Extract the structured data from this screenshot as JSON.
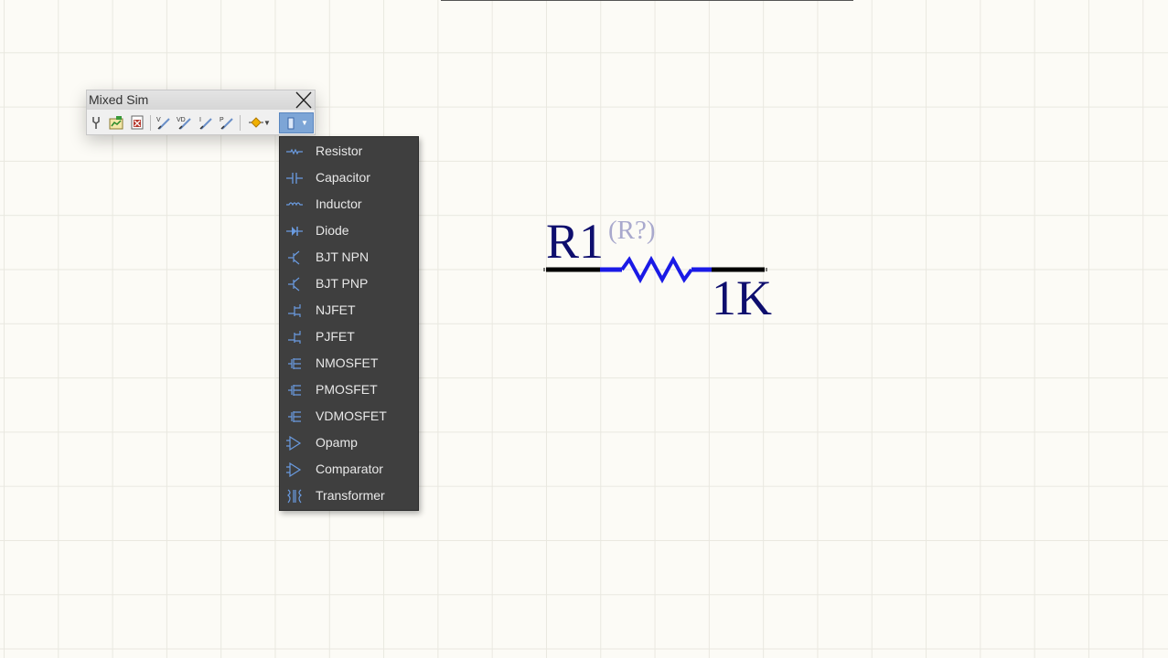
{
  "toolbar": {
    "title": "Mixed Sim",
    "buttons": [
      {
        "icon": "probe-icon"
      },
      {
        "icon": "sim-dashboard-icon"
      },
      {
        "icon": "spreadsheet-icon"
      },
      {
        "icon": "voltage-probe-icon"
      },
      {
        "icon": "differential-voltage-probe-icon"
      },
      {
        "icon": "current-probe-icon"
      },
      {
        "icon": "power-probe-icon"
      },
      {
        "icon": "source-icon"
      },
      {
        "icon": "components-icon"
      }
    ],
    "colors": {
      "active": "#7da5d6",
      "accent_icon": "#f0b000"
    }
  },
  "menu": {
    "items": [
      {
        "label": "Resistor",
        "icon": "resistor-icon"
      },
      {
        "label": "Capacitor",
        "icon": "capacitor-icon"
      },
      {
        "label": "Inductor",
        "icon": "inductor-icon"
      },
      {
        "label": "Diode",
        "icon": "diode-icon"
      },
      {
        "label": "BJT NPN",
        "icon": "bjt-npn-icon"
      },
      {
        "label": "BJT PNP",
        "icon": "bjt-pnp-icon"
      },
      {
        "label": "NJFET",
        "icon": "njfet-icon"
      },
      {
        "label": "PJFET",
        "icon": "pjfet-icon"
      },
      {
        "label": "NMOSFET",
        "icon": "nmosfet-icon"
      },
      {
        "label": "PMOSFET",
        "icon": "pmosfet-icon"
      },
      {
        "label": "VDMOSFET",
        "icon": "vdmosfet-icon"
      },
      {
        "label": "Opamp",
        "icon": "opamp-icon"
      },
      {
        "label": "Comparator",
        "icon": "comparator-icon"
      },
      {
        "label": "Transformer",
        "icon": "transformer-icon"
      }
    ],
    "colors": {
      "background": "#3f3f3f",
      "text": "#e8e8e8",
      "icon": "#6a9be0"
    }
  },
  "schematic": {
    "designator": "R1",
    "designator_hint": "(R?)",
    "comment": "1K",
    "colors": {
      "text": "#0e0e6e",
      "hint": "#a9a9cd",
      "wire": "#000000",
      "body": "#1a1ae6"
    }
  }
}
